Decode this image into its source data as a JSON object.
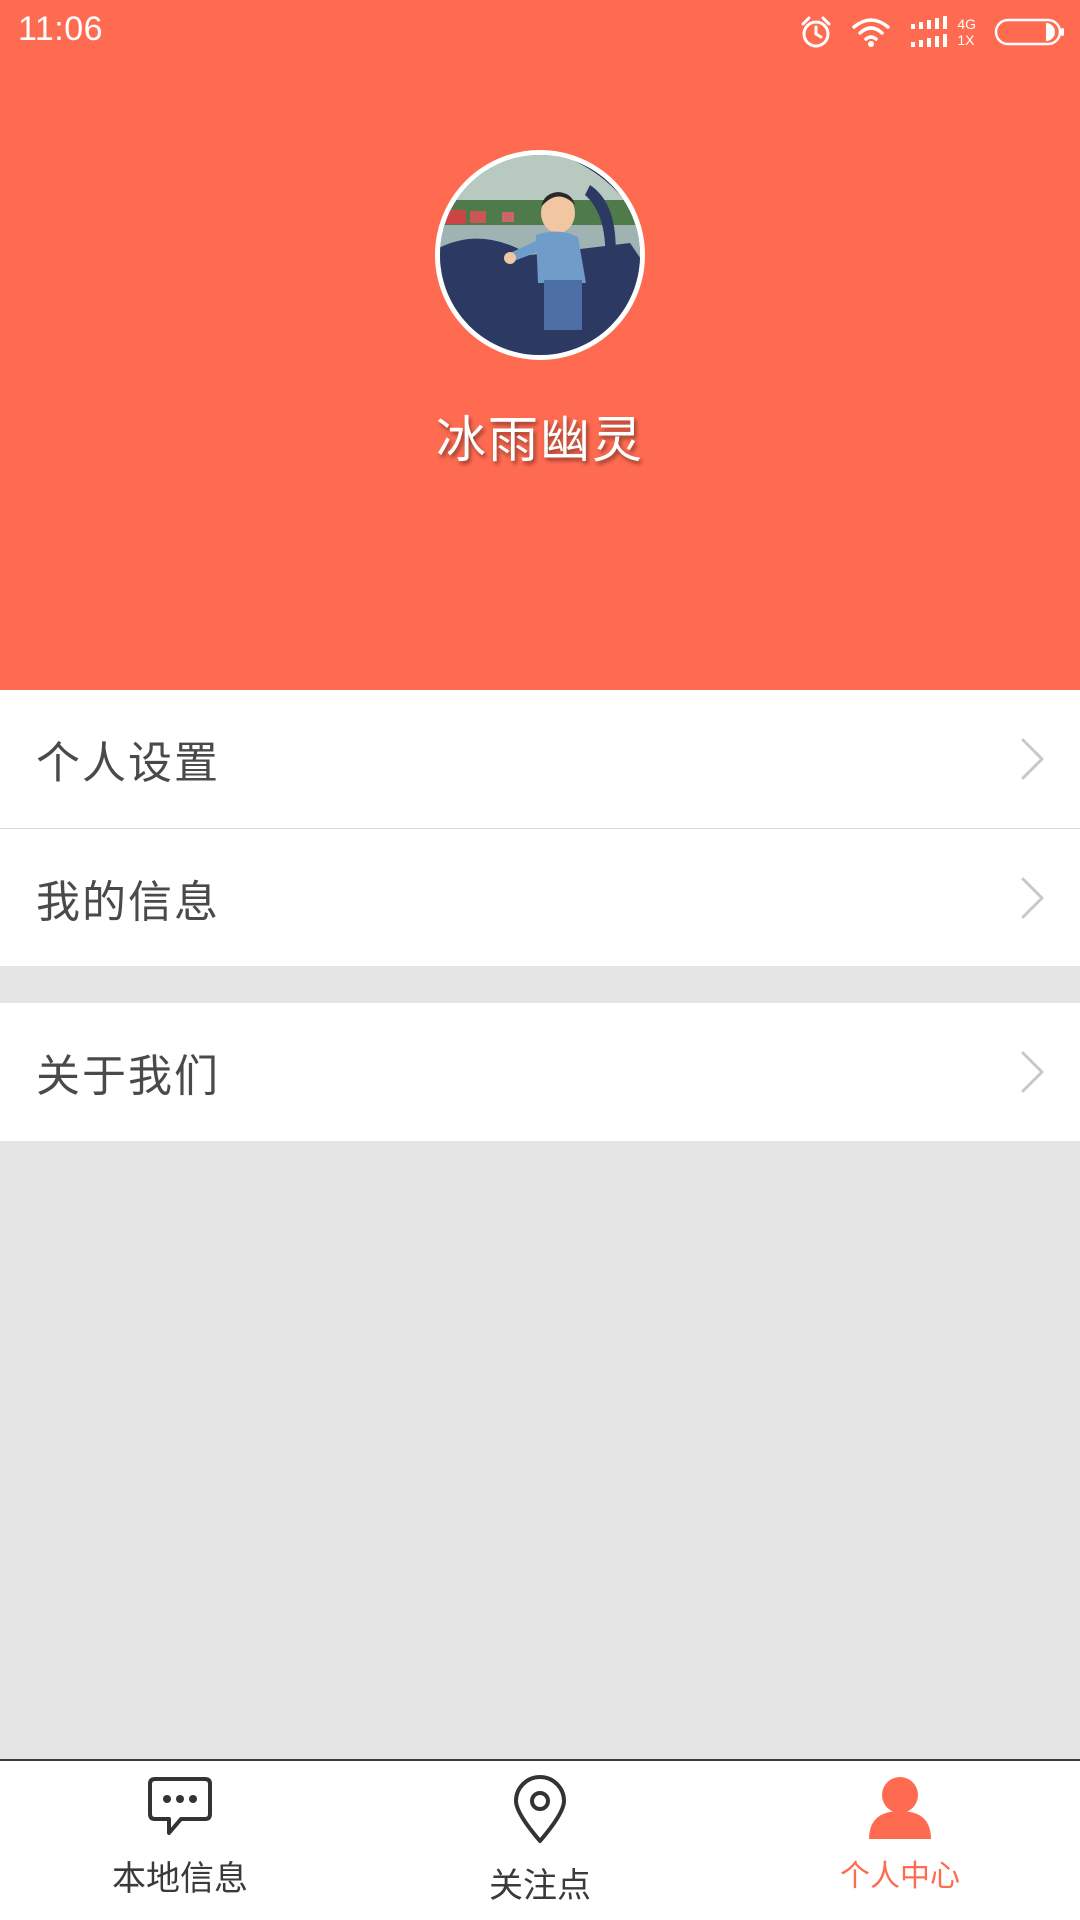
{
  "status_bar": {
    "time": "11:06",
    "network_top": "4G",
    "network_bottom": "1X",
    "icons": [
      "alarm-icon",
      "wifi-icon",
      "signal-icon",
      "battery-icon"
    ]
  },
  "profile": {
    "username": "冰雨幽灵",
    "avatar": "avatar-photo"
  },
  "menu_group_1": [
    {
      "label": "个人设置",
      "icon": "chevron-right-icon"
    },
    {
      "label": "我的信息",
      "icon": "chevron-right-icon"
    }
  ],
  "menu_group_2": [
    {
      "label": "关于我们",
      "icon": "chevron-right-icon"
    }
  ],
  "tabbar": {
    "tabs": [
      {
        "label": "本地信息",
        "icon": "message-icon",
        "active": false
      },
      {
        "label": "关注点",
        "icon": "location-pin-icon",
        "active": false
      },
      {
        "label": "个人中心",
        "icon": "person-icon",
        "active": true
      }
    ]
  },
  "colors": {
    "accent": "#ff6b51",
    "background": "#e5e5e5",
    "text": "#4a4a4a",
    "chevron": "#c8c8c8"
  }
}
